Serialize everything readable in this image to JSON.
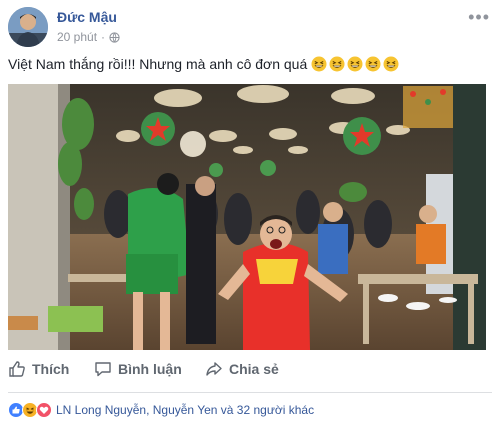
{
  "post": {
    "author": "Đức Mậu",
    "time": "20 phút",
    "separator": "·",
    "text": "Việt Nam thắng rồi!!! Nhưng mà anh cô đơn quá",
    "emojis": [
      "grinning-squinting-face",
      "grinning-squinting-face",
      "grinning-squinting-face",
      "grinning-squinting-face",
      "grinning-squinting-face"
    ],
    "more": "•••"
  },
  "actions": {
    "like": "Thích",
    "comment": "Bình luận",
    "share": "Chia sẻ"
  },
  "reactions": {
    "icons": [
      "like-reaction-icon",
      "haha-reaction-icon",
      "love-reaction-icon"
    ],
    "summary": "LN Long Nguyễn, Nguyễn Yen và 32 người khác"
  },
  "colors": {
    "link": "#365899",
    "muted": "#90949c",
    "action": "#606770",
    "like": "#4080ff",
    "love": "#f25268",
    "haha": "#f7b125"
  }
}
